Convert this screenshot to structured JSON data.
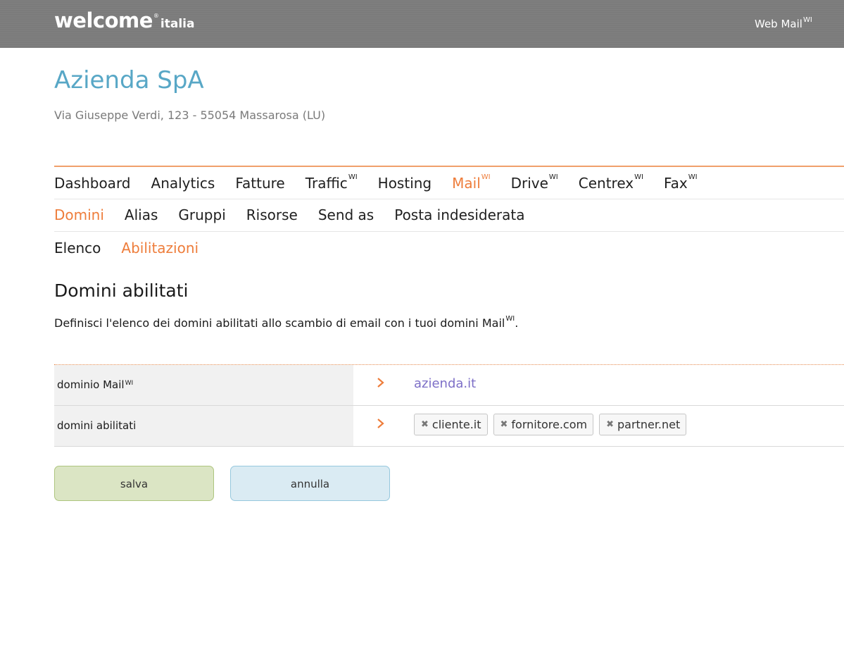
{
  "header": {
    "logo_main": "welcome",
    "logo_reg": "®",
    "logo_sub": "italia",
    "webmail_label": "Web Mail",
    "webmail_sup": "WI"
  },
  "company": {
    "name": "Azienda SpA",
    "address": "Via Giuseppe Verdi, 123 - 55054 Massarosa (LU)"
  },
  "nav_main": [
    {
      "label": "Dashboard",
      "sup": ""
    },
    {
      "label": "Analytics",
      "sup": ""
    },
    {
      "label": "Fatture",
      "sup": ""
    },
    {
      "label": "Traffic",
      "sup": "WI"
    },
    {
      "label": "Hosting",
      "sup": ""
    },
    {
      "label": "Mail",
      "sup": "WI",
      "active": true
    },
    {
      "label": "Drive",
      "sup": "WI"
    },
    {
      "label": "Centrex",
      "sup": "WI"
    },
    {
      "label": "Fax",
      "sup": "WI"
    }
  ],
  "nav_sub": [
    {
      "label": "Domini",
      "active": true
    },
    {
      "label": "Alias"
    },
    {
      "label": "Gruppi"
    },
    {
      "label": "Risorse"
    },
    {
      "label": "Send as"
    },
    {
      "label": "Posta indesiderata"
    }
  ],
  "nav_third": [
    {
      "label": "Elenco"
    },
    {
      "label": "Abilitazioni",
      "active": true
    }
  ],
  "section": {
    "title": "Domini abilitati",
    "description": "Definisci l'elenco dei domini abilitati allo scambio di email con i tuoi domini Mail",
    "description_sup": "WI",
    "description_end": "."
  },
  "form": {
    "domain_label": "dominio Mail",
    "domain_label_sup": "WI",
    "domain_value": "azienda.it",
    "enabled_label": "domini abilitati",
    "enabled_domains": [
      "cliente.it",
      "fornitore.com",
      "partner.net"
    ]
  },
  "buttons": {
    "save": "salva",
    "cancel": "annulla"
  },
  "colors": {
    "accent_orange": "#ee7d3b",
    "company_blue": "#58a7c6",
    "link_purple": "#7d6fc7",
    "header_gray": "#7b7b7b"
  }
}
